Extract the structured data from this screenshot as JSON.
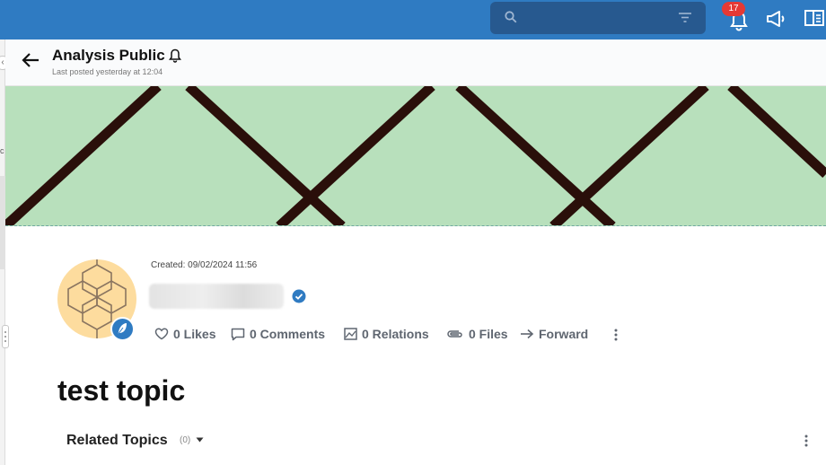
{
  "topbar": {
    "notification_count": "17",
    "search": {
      "placeholder": "",
      "value": ""
    }
  },
  "header": {
    "title": "Analysis Public",
    "subtitle": "Last posted yesterday at 12:04"
  },
  "post": {
    "created": "Created: 09/02/2024 11:56",
    "actions": {
      "likes": "0 Likes",
      "comments": "0 Comments",
      "relations": "0 Relations",
      "files": "0 Files",
      "forward": "Forward"
    },
    "topic_title": "test topic",
    "related": {
      "label": "Related Topics",
      "count": "(0)"
    }
  },
  "leftrail": {
    "fragment": "c"
  },
  "colors": {
    "topbar": "#2f7bc2",
    "search_bg": "#27598f",
    "banner_bg": "#b8e0bc",
    "banner_lines": "#2a0f0a",
    "badge": "#e53935",
    "avatar_bg": "#fddc9e",
    "verified": "#2f7bc2"
  }
}
